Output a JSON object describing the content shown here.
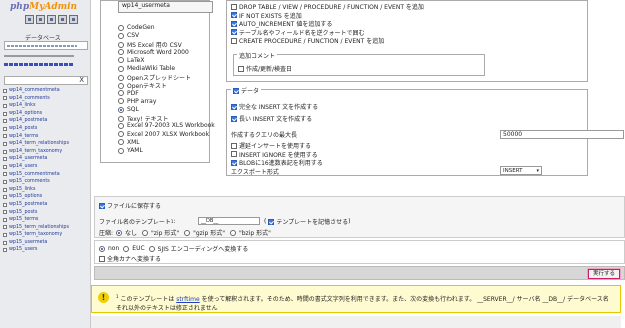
{
  "nav": {
    "logo_part1": "php",
    "logo_part2": "MyAdmin",
    "icons": [
      "home-icon",
      "exit-icon",
      "docs-icon",
      "sql-icon",
      "settings-icon"
    ],
    "db_label": "データベース",
    "filter_clear": "X",
    "tables": [
      "wp14_commentmeta",
      "wp14_comments",
      "wp14_links",
      "wp14_options",
      "wp14_postmeta",
      "wp14_posts",
      "wp14_terms",
      "wp14_term_relationships",
      "wp14_term_taxonomy",
      "wp14_usermeta",
      "wp14_users",
      "wp15_commentmeta",
      "wp15_comments",
      "wp15_links",
      "wp15_options",
      "wp15_postmeta",
      "wp15_posts",
      "wp15_terms",
      "wp15_term_relationships",
      "wp15_term_taxonomy",
      "wp15_usermeta",
      "wp15_users"
    ]
  },
  "formats": {
    "list_top": "wp14_usermeta",
    "items": [
      {
        "label": "CodeGen",
        "selected": false
      },
      {
        "label": "CSV",
        "selected": false
      },
      {
        "label": "MS Excel 用の CSV",
        "selected": false
      },
      {
        "label": "Microsoft Word 2000",
        "selected": false
      },
      {
        "label": "LaTeX",
        "selected": false
      },
      {
        "label": "MediaWiki Table",
        "selected": false
      },
      {
        "label": "Openスプレッドシート",
        "selected": false
      },
      {
        "label": "Openテキスト",
        "selected": false
      },
      {
        "label": "PDF",
        "selected": false
      },
      {
        "label": "PHP array",
        "selected": false
      },
      {
        "label": "SQL",
        "selected": true
      },
      {
        "label": "Texy! テキスト",
        "selected": false
      },
      {
        "label": "Excel 97-2003 XLS Workbook",
        "selected": false
      },
      {
        "label": "Excel 2007 XLSX Workbook",
        "selected": false
      },
      {
        "label": "XML",
        "selected": false
      },
      {
        "label": "YAML",
        "selected": false
      }
    ]
  },
  "structure": {
    "options": [
      {
        "label": "DROP TABLE / VIEW / PROCEDURE / FUNCTION / EVENT を追加",
        "checked": false
      },
      {
        "label": "IF NOT EXISTS を追加",
        "checked": true
      },
      {
        "label": "AUTO_INCREMENT 値を追加する",
        "checked": true
      },
      {
        "label": "テーブル名やフィールド名を逆クォートで囲む",
        "checked": true
      },
      {
        "label": "CREATE PROCEDURE / FUNCTION / EVENT を追加",
        "checked": false
      }
    ],
    "comment_legend": "追加コメント",
    "comment_option": "作成/更新/検査日"
  },
  "data": {
    "legend": "データ",
    "options": [
      {
        "label": "完全な INSERT 文を作成する",
        "checked": true
      },
      {
        "label": "長い INSERT 文を作成する",
        "checked": true
      }
    ],
    "maxlen_label": "作成するクエリの最大長",
    "maxlen_value": "50000",
    "options2": [
      {
        "label": "遅延インサートを使用する",
        "checked": false
      },
      {
        "label": "INSERT IGNORE を使用する",
        "checked": false
      },
      {
        "label": "BLOBに16進数表記を利用する",
        "checked": true
      }
    ],
    "export_label": "エクスポート形式",
    "export_value": "INSERT"
  },
  "file": {
    "save_label": "ファイルに保存する",
    "save_checked": true,
    "template_label": "ファイル名のテンプレート",
    "template_superscript": "1",
    "template_value": "__DB__",
    "remember_label": "テンプレートを記憶させる",
    "remember_checked": true,
    "compress_label": "圧縮:",
    "compress_options": [
      {
        "label": "なし",
        "selected": true
      },
      {
        "label": "\"zip 形式\"",
        "selected": false
      },
      {
        "label": "\"gzip 形式\"",
        "selected": false
      },
      {
        "label": "\"bzip 形式\"",
        "selected": false
      }
    ]
  },
  "encoding": {
    "options": [
      {
        "label": "non",
        "selected": true
      },
      {
        "label": "EUC",
        "selected": false
      },
      {
        "label": "SJIS エンコーディングへ変換する",
        "selected": false
      }
    ],
    "kana_label": "全角カナへ変換する",
    "kana_checked": false
  },
  "exec_button": "実行する",
  "notice": {
    "superscript": "1",
    "before_link": " このテンプレートは ",
    "link": "strftime",
    "after_link": " を使って解釈されます。そのため、時間の書式文字列を利用できます。また、次の変換も行われます。 __SERVER__/ サーバ名 __DB__/ データベース名 それ以外のテキストは修正されません",
    "icon_glyph": "!"
  }
}
